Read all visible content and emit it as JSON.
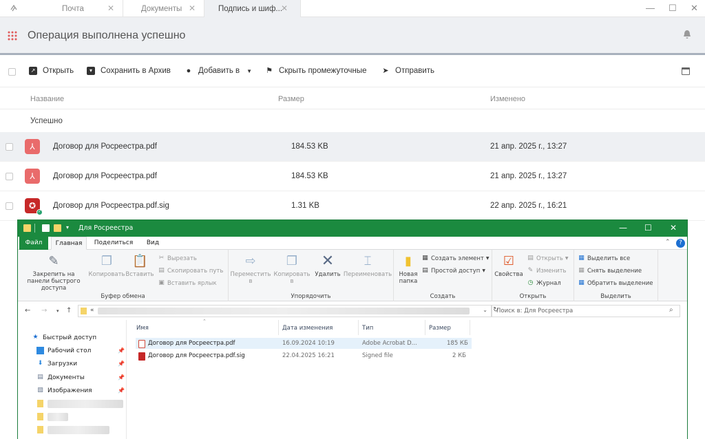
{
  "tabs": [
    {
      "label": "Почта"
    },
    {
      "label": "Документы"
    },
    {
      "label": "Подпись и шиф..."
    }
  ],
  "header": {
    "title": "Операция выполнена успешно"
  },
  "toolbar": {
    "open": "Открыть",
    "save_archive": "Сохранить в Архив",
    "add_to": "Добавить в",
    "hide_intermediate": "Скрыть промежуточные",
    "send": "Отправить"
  },
  "columns": {
    "name": "Название",
    "size": "Размер",
    "modified": "Изменено"
  },
  "group": "Успешно",
  "files": [
    {
      "name": "Договор для Росреестра.pdf",
      "size": "184.53 KB",
      "modified": "21 апр. 2025 г., 13:27"
    },
    {
      "name": "Договор для Росреестра.pdf",
      "size": "184.53 KB",
      "modified": "21 апр. 2025 г., 13:27"
    },
    {
      "name": "Договор для Росреестра.pdf.sig",
      "size": "1.31 KB",
      "modified": "22 апр. 2025 г., 16:21"
    }
  ],
  "explorer": {
    "title": "Для Росреестра",
    "ribbon_tabs": [
      "Файл",
      "Главная",
      "Поделиться",
      "Вид"
    ],
    "clipboard": {
      "pin": "Закрепить на панели быстрого доступа",
      "copy": "Копировать",
      "paste": "Вставить",
      "cut": "Вырезать",
      "copy_path": "Скопировать путь",
      "paste_shortcut": "Вставить ярлык",
      "caption": "Буфер обмена"
    },
    "organize": {
      "move": "Переместить в",
      "copy_to": "Копировать в",
      "delete": "Удалить",
      "rename": "Переименовать",
      "caption": "Упорядочить"
    },
    "create": {
      "new_folder": "Новая папка",
      "new_item": "Создать элемент",
      "easy_access": "Простой доступ",
      "caption": "Создать"
    },
    "open_group": {
      "properties": "Свойства",
      "open": "Открыть",
      "edit": "Изменить",
      "history": "Журнал",
      "caption": "Открыть"
    },
    "select": {
      "select_all": "Выделить все",
      "select_none": "Снять выделение",
      "invert": "Обратить выделение",
      "caption": "Выделить"
    },
    "address_prefix": "«",
    "search_placeholder": "Поиск в: Для Росреестра",
    "nav": {
      "quick_access": "Быстрый доступ",
      "desktop": "Рабочий стол",
      "downloads": "Загрузки",
      "documents": "Документы",
      "pictures": "Изображения"
    },
    "columns": {
      "name": "Имя",
      "date": "Дата изменения",
      "type": "Тип",
      "size": "Размер"
    },
    "files": [
      {
        "name": "Договор для Росреестра.pdf",
        "date": "16.09.2024 10:19",
        "type": "Adobe Acrobat D...",
        "size": "185 КБ"
      },
      {
        "name": "Договор для Росреестра.pdf.sig",
        "date": "22.04.2025 16:21",
        "type": "Signed file",
        "size": "2 КБ"
      }
    ]
  },
  "colors": {
    "accent_green": "#1b8a3f",
    "pdf_red": "#e96b6b",
    "sig_red": "#c62828",
    "header_bg": "#eef0f3"
  }
}
